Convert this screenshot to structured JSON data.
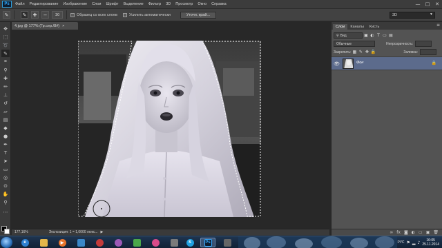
{
  "app": {
    "logo": "Ps"
  },
  "menu": [
    "Файл",
    "Редактирование",
    "Изображение",
    "Слои",
    "Шрифт",
    "Выделение",
    "Фильтр",
    "3D",
    "Просмотр",
    "Окно",
    "Справка"
  ],
  "window_controls": {
    "minimize": "—",
    "maximize": "□",
    "close": "✕"
  },
  "options": {
    "brush_size": "30",
    "sample_all_layers": "Образец со всех слоев",
    "auto_enhance": "Усилить автоматически",
    "refine_edge": "Уточн. край...",
    "workspace": "3D"
  },
  "document": {
    "tab_title": "4.jpg @ 177% (Гр.сер./8#)",
    "tab_close": "×"
  },
  "status": {
    "zoom": "177,16%",
    "info": "Экспозиция: 1 = 1,0000 люкс...",
    "arrow": "▶"
  },
  "layers_panel": {
    "tabs": [
      "Слои",
      "Каналы",
      "Кисть"
    ],
    "kind_label": "Вид",
    "blend_mode": "Обычные",
    "opacity_label": "Непрозрачность:",
    "lock_label": "Закрепить:",
    "fill_label": "Заливка:",
    "layer_name": "Фон"
  },
  "taskbar": {
    "photoshop_label": "Ps",
    "lang": "РУС",
    "time": "16:05",
    "date": "25.11.2014"
  }
}
